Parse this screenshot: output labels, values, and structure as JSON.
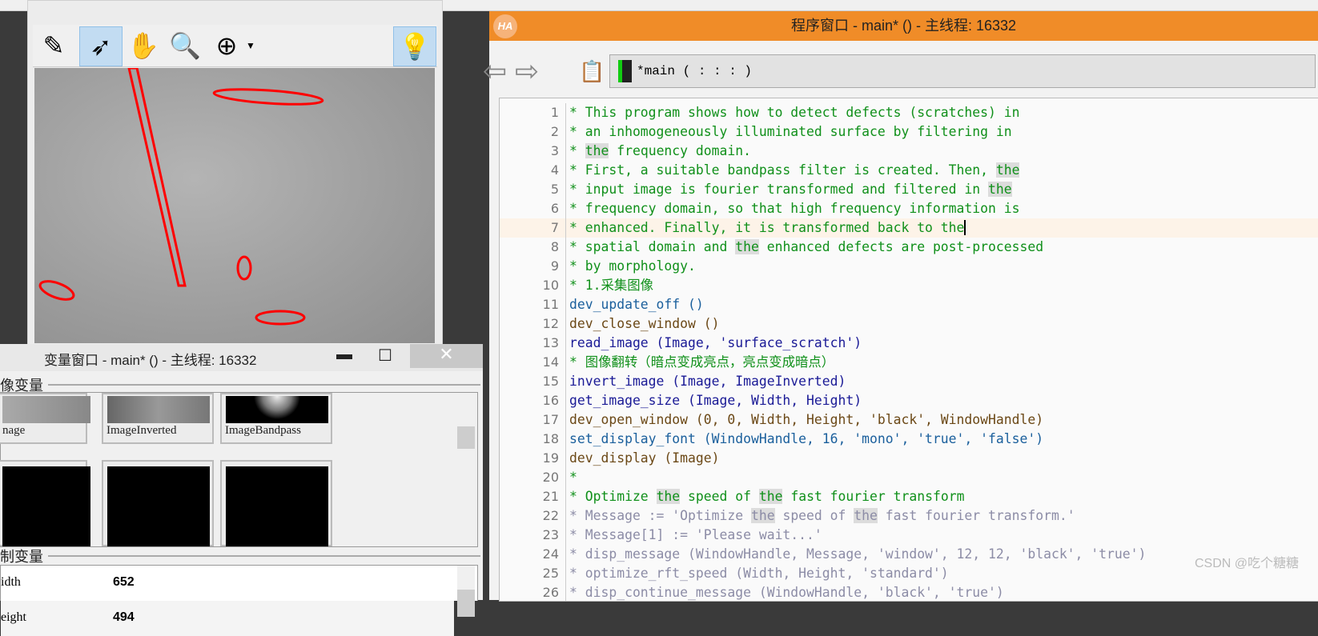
{
  "image_window": {
    "toolbar": [
      {
        "icon": "edit-roi-icon"
      },
      {
        "icon": "pointer-icon",
        "selected": true
      },
      {
        "icon": "pan-hand-icon"
      },
      {
        "icon": "magnify-icon"
      },
      {
        "icon": "zoom-in-icon"
      },
      {
        "icon": "lightbulb-icon",
        "selected": true
      }
    ]
  },
  "variable_window": {
    "title": "变量窗口 - main* () - 主线程: 16332",
    "iconic_section": "像变量",
    "control_section": "制变量",
    "thumbnails": [
      "nage",
      "ImageInverted",
      "ImageBandpass"
    ],
    "controls": [
      {
        "name": "idth",
        "value": "652"
      },
      {
        "name": "eight",
        "value": "494"
      }
    ]
  },
  "program_window": {
    "title": "程序窗口 - main* () - 主线程: 16332",
    "logo": "HA",
    "breadcrumb": "*main ( : : : )",
    "lines": [
      {
        "type": "comment",
        "segs": [
          "* This program shows how to detect defects (scratches) in"
        ]
      },
      {
        "type": "comment",
        "segs": [
          "* an inhomogeneously illuminated surface by filtering in"
        ]
      },
      {
        "type": "comment",
        "segs": [
          "* ",
          {
            "hl": "the"
          },
          " frequency domain."
        ]
      },
      {
        "type": "comment",
        "segs": [
          "* First, a suitable bandpass filter is created. Then, ",
          {
            "hl": "the"
          }
        ]
      },
      {
        "type": "comment",
        "segs": [
          "* input image is fourier transformed and filtered in ",
          {
            "hl": "the"
          }
        ]
      },
      {
        "type": "comment",
        "segs": [
          "* frequency domain, so that high frequency information is"
        ]
      },
      {
        "type": "comment",
        "current": true,
        "segs": [
          "* enhanced. Finally, it is transformed back to the"
        ]
      },
      {
        "type": "comment",
        "segs": [
          "* spatial domain and ",
          {
            "hl": "the"
          },
          " enhanced defects are post-processed"
        ]
      },
      {
        "type": "comment",
        "segs": [
          "* by morphology."
        ]
      },
      {
        "type": "comment",
        "segs": [
          "* 1.采集图像"
        ]
      },
      {
        "type": "op2",
        "segs": [
          "dev_update_off ()"
        ]
      },
      {
        "type": "dev",
        "segs": [
          "dev_close_window ()"
        ]
      },
      {
        "type": "op",
        "segs": [
          "read_image (Image, 'surface_scratch')"
        ]
      },
      {
        "type": "comment",
        "segs": [
          "* 图像翻转（暗点变成亮点，亮点变成暗点）"
        ]
      },
      {
        "type": "op",
        "segs": [
          "invert_image (Image, ImageInverted)"
        ]
      },
      {
        "type": "op",
        "segs": [
          "get_image_size (Image, Width, Height)"
        ]
      },
      {
        "type": "dev",
        "segs": [
          "dev_open_window (0, 0, Width, Height, 'black', WindowHandle)"
        ]
      },
      {
        "type": "op2",
        "segs": [
          "set_display_font (WindowHandle, 16, 'mono', 'true', 'false')"
        ]
      },
      {
        "type": "dev",
        "segs": [
          "dev_display (Image)"
        ]
      },
      {
        "type": "comment",
        "segs": [
          "*"
        ]
      },
      {
        "type": "comment",
        "segs": [
          "* Optimize ",
          {
            "hl": "the"
          },
          " speed of ",
          {
            "hl": "the"
          },
          " fast fourier transform"
        ]
      },
      {
        "type": "disabled",
        "segs": [
          "* Message := 'Optimize ",
          {
            "hl": "the"
          },
          " speed of ",
          {
            "hl": "the"
          },
          " fast fourier transform.'"
        ]
      },
      {
        "type": "disabled",
        "segs": [
          "* Message[1] := 'Please wait...'"
        ]
      },
      {
        "type": "disabled",
        "segs": [
          "* disp_message (WindowHandle, Message, 'window', 12, 12, 'black', 'true')"
        ]
      },
      {
        "type": "disabled",
        "segs": [
          "* optimize_rft_speed (Width, Height, 'standard')"
        ]
      },
      {
        "type": "disabled",
        "segs": [
          "* disp_continue_message (WindowHandle, 'black', 'true')"
        ]
      }
    ]
  },
  "watermark": "CSDN @吃个糖糖",
  "colors": {
    "title_bar": "#f08c28",
    "comment": "#10901a",
    "highlight": "#dcdcdc",
    "region": "#ff0000"
  }
}
